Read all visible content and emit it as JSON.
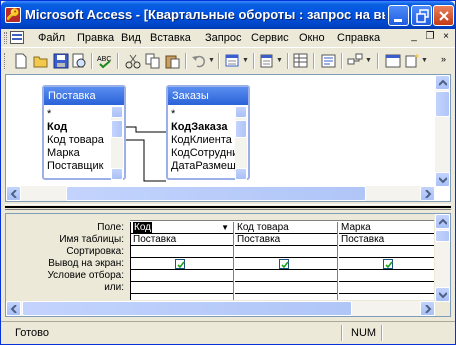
{
  "window": {
    "title": "Microsoft Access - [Квартальные обороты : запрос на выбор..."
  },
  "menubar": {
    "items": [
      "Файл",
      "Правка",
      "Вид",
      "Вставка",
      "Запрос",
      "Сервис",
      "Окно",
      "Справка"
    ],
    "mdi_minimize": "_",
    "mdi_restore": "❐",
    "mdi_close": "×"
  },
  "toolbar": {
    "icons": [
      "new-icon",
      "open-icon",
      "save-icon",
      "print-preview-icon",
      "spelling-icon",
      "cut-icon",
      "copy-icon",
      "paste-icon",
      "undo-icon",
      "query-type-icon",
      "run-icon",
      "show-table-icon",
      "properties-icon",
      "build-icon",
      "more-icon"
    ]
  },
  "tables": [
    {
      "name": "Поставка",
      "fields": [
        "*",
        "Код",
        "Код товара",
        "Марка",
        "Поставщик"
      ],
      "bold_field": "Код"
    },
    {
      "name": "Заказы",
      "fields": [
        "*",
        "КодЗаказа",
        "КодКлиента",
        "КодСотрудни",
        "ДатаРазмеще"
      ],
      "bold_field": "КодЗаказа"
    }
  ],
  "qbe": {
    "row_labels": [
      "Поле:",
      "Имя таблицы:",
      "Сортировка:",
      "Вывод на экран:",
      "Условие отбора:",
      "или:"
    ],
    "columns": [
      {
        "field": "Код",
        "table": "Поставка",
        "sort": "",
        "show": true
      },
      {
        "field": "Код товара",
        "table": "Поставка",
        "sort": "",
        "show": true
      },
      {
        "field": "Марка",
        "table": "Поставка",
        "sort": "",
        "show": true
      }
    ]
  },
  "statusbar": {
    "text": "Готово",
    "num": "NUM"
  }
}
